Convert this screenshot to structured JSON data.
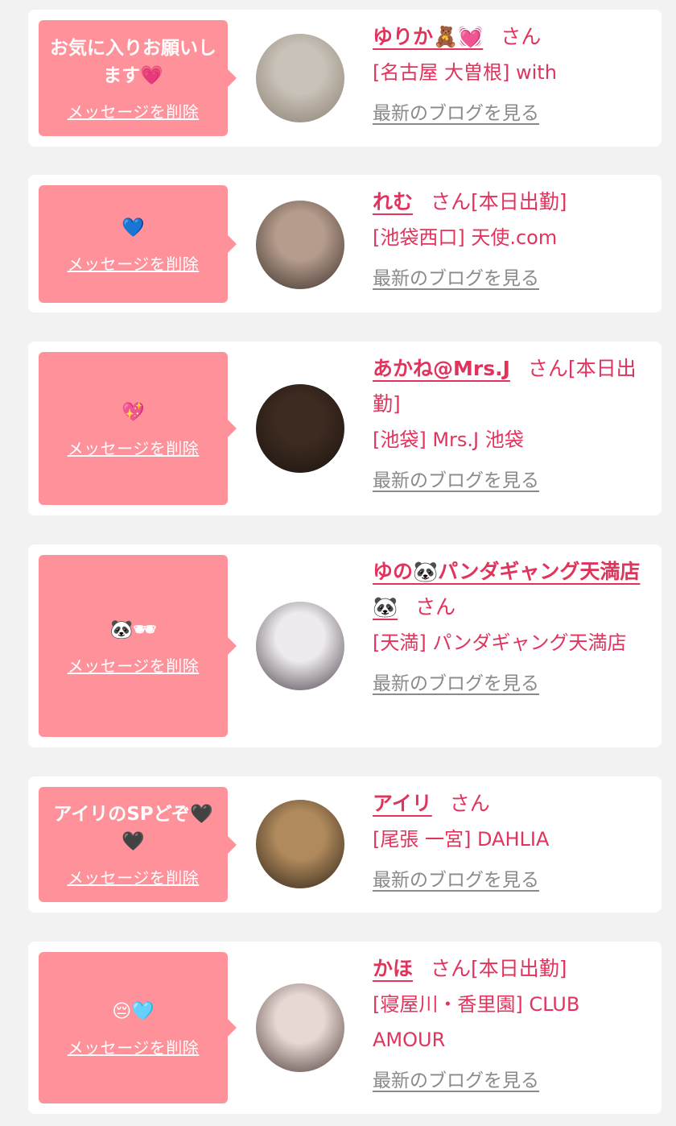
{
  "favorites": [
    {
      "memo": "お気に入りお願いします💗",
      "delete_label": "メッセージを削除",
      "name": "ゆりか🧸💓",
      "honorific": "さん",
      "status": "",
      "shop": "[名古屋 大曽根] with",
      "blog_label": "最新のブログを見る",
      "avatar_colors": [
        "#c9c2b8",
        "#8a7f73"
      ]
    },
    {
      "memo": "💙",
      "delete_label": "メッセージを削除",
      "name": "れむ",
      "honorific": "さん",
      "status": "[本日出勤]",
      "shop": "[池袋西口] 天使.com",
      "blog_label": "最新のブログを見る",
      "avatar_colors": [
        "#b59c8c",
        "#3a2f2a"
      ]
    },
    {
      "memo": "💖",
      "delete_label": "メッセージを削除",
      "name": "あかね@Mrs.J",
      "honorific": "さん",
      "status": "[本日出勤]",
      "shop": "[池袋] Mrs.J 池袋",
      "blog_label": "最新のブログを見る",
      "avatar_colors": [
        "#3d2a20",
        "#1a1410"
      ]
    },
    {
      "memo": "🐼🕶",
      "delete_label": "メッセージを削除",
      "name": "ゆの🐼パンダギャング天満店🐼",
      "honorific": "さん",
      "status": "",
      "shop": "[天満] パンダギャング天満店",
      "blog_label": "最新のブログを見る",
      "avatar_colors": [
        "#eeeaf0",
        "#4a4248"
      ]
    },
    {
      "memo": "アイリのSPどぞ🖤🖤",
      "delete_label": "メッセージを削除",
      "name": "アイリ",
      "honorific": "さん",
      "status": "",
      "shop": "[尾張 一宮] DAHLIA",
      "blog_label": "最新のブログを見る",
      "avatar_colors": [
        "#b08a5c",
        "#2e2218"
      ]
    },
    {
      "memo": "😔🩵",
      "delete_label": "メッセージを削除",
      "name": "かほ",
      "honorific": "さん",
      "status": "[本日出勤]",
      "shop": "[寝屋川・香里園] CLUB AMOUR",
      "blog_label": "最新のブログを見る",
      "avatar_colors": [
        "#e8d8d4",
        "#4b3a36"
      ]
    }
  ]
}
